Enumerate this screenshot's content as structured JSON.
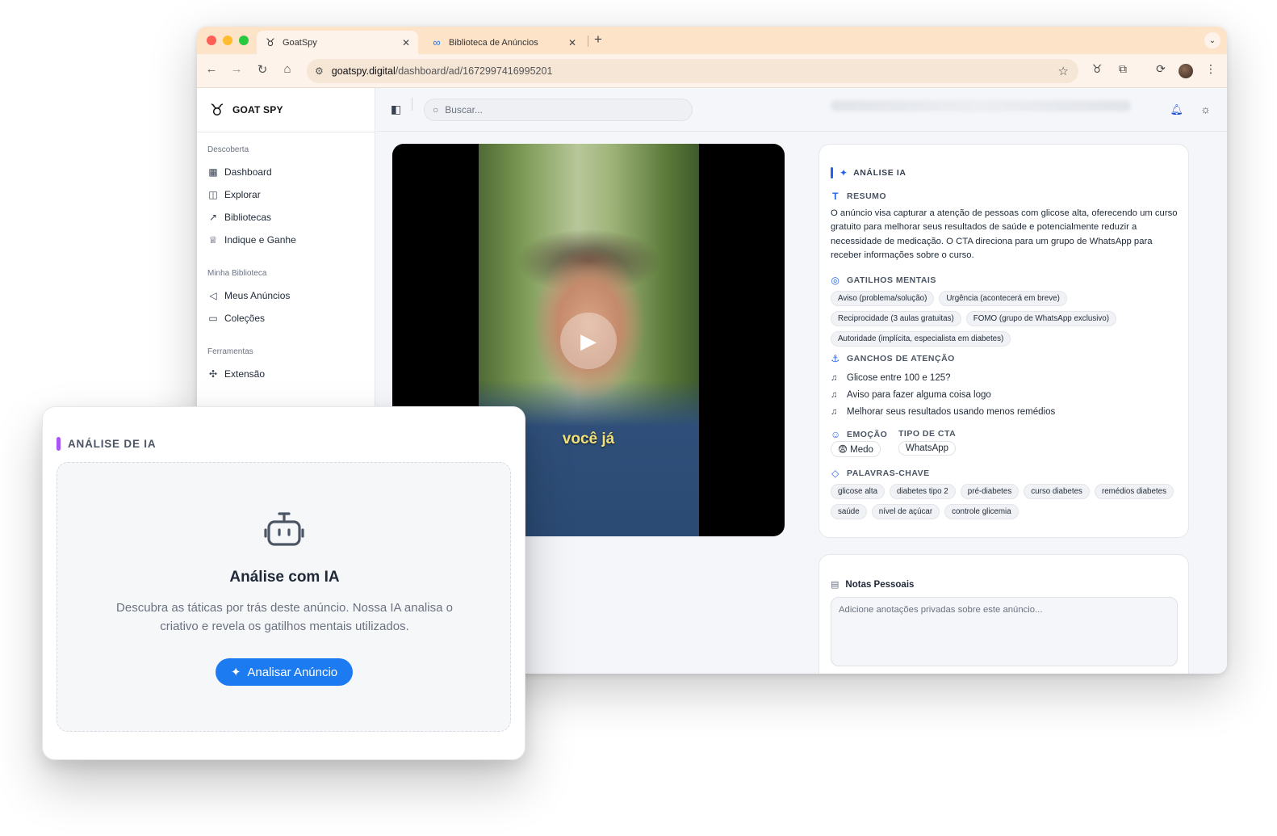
{
  "browser": {
    "tabs": [
      {
        "title": "GoatSpy",
        "favicon": "goat-logo-icon",
        "active": true
      },
      {
        "title": "Biblioteca de Anúncios",
        "favicon": "meta-logo-icon",
        "active": false
      }
    ],
    "url_host": "goatspy.digital",
    "url_path": "/dashboard/ad/1672997416995201"
  },
  "sidebar": {
    "brand": "GOAT SPY",
    "sections": [
      {
        "label": "Descoberta",
        "items": [
          {
            "label": "Dashboard",
            "icon": "grid-icon"
          },
          {
            "label": "Explorar",
            "icon": "explore-icon"
          },
          {
            "label": "Bibliotecas",
            "icon": "chart-line-icon"
          },
          {
            "label": "Indique e Ganhe",
            "icon": "trophy-icon"
          }
        ]
      },
      {
        "label": "Minha Biblioteca",
        "items": [
          {
            "label": "Meus Anúncios",
            "icon": "megaphone-icon"
          },
          {
            "label": "Coleções",
            "icon": "folder-icon"
          }
        ]
      },
      {
        "label": "Ferramentas",
        "items": [
          {
            "label": "Extensão",
            "icon": "puzzle-icon"
          }
        ]
      }
    ]
  },
  "topbar": {
    "search_placeholder": "Buscar..."
  },
  "video": {
    "caption": "você já"
  },
  "analysis": {
    "title": "ANÁLISE IA",
    "summary_label": "RESUMO",
    "summary": "O anúncio visa capturar a atenção de pessoas com glicose alta, oferecendo um curso gratuito para melhorar seus resultados de saúde e potencialmente reduzir a necessidade de medicação. O CTA direciona para um grupo de WhatsApp para receber informações sobre o curso.",
    "triggers_label": "GATILHOS MENTAIS",
    "triggers": [
      "Aviso (problema/solução)",
      "Urgência (acontecerá em breve)",
      "Reciprocidade (3 aulas gratuitas)",
      "FOMO (grupo de WhatsApp exclusivo)",
      "Autoridade (implícita, especialista em diabetes)"
    ],
    "hooks_label": "GANCHOS DE ATENÇÃO",
    "hooks": [
      "Glicose entre 100 e 125?",
      "Aviso para fazer alguma coisa logo",
      "Melhorar seus resultados usando menos remédios"
    ],
    "emotion_label": "EMOÇÃO",
    "emotion_value": "😨 Medo",
    "cta_label": "TIPO DE CTA",
    "cta_value": "WhatsApp",
    "keywords_label": "PALAVRAS-CHAVE",
    "keywords": [
      "glicose alta",
      "diabetes tipo 2",
      "pré-diabetes",
      "curso diabetes",
      "remédios diabetes",
      "saúde",
      "nível de açúcar",
      "controle glicemia"
    ]
  },
  "notes": {
    "title": "Notas Pessoais",
    "placeholder": "Adicione anotações privadas sobre este anúncio..."
  },
  "ai_card": {
    "title": "ANÁLISE DE IA",
    "heading": "Análise com IA",
    "description": "Descubra as táticas por trás deste anúncio. Nossa IA analisa o criativo e revela os gatilhos mentais utilizados.",
    "button_label": "Analisar Anúncio",
    "accent_color": "#a855f7",
    "button_color": "#1d7bf2"
  }
}
